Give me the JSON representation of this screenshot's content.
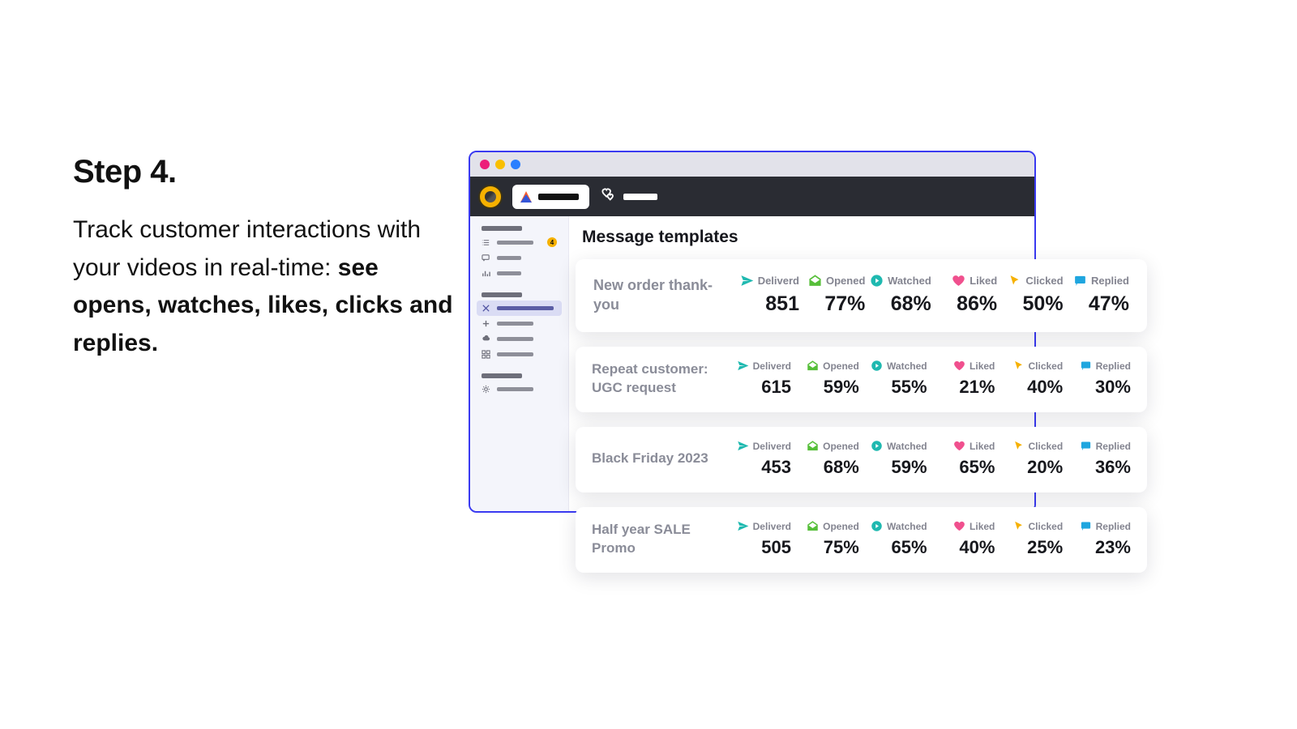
{
  "left": {
    "title": "Step 4.",
    "line1": "Track customer interactions with your videos in real-time: ",
    "bold": "see opens, watches, likes, clicks and replies."
  },
  "page": {
    "title": "Message templates"
  },
  "sidebar": {
    "badge": "4"
  },
  "columns": {
    "delivered": "Deliverd",
    "opened": "Opened",
    "watched": "Watched",
    "liked": "Liked",
    "clicked": "Clicked",
    "replied": "Replied"
  },
  "templates": [
    {
      "name": "New order thank-you",
      "delivered": "851",
      "opened": "77%",
      "watched": "68%",
      "liked": "86%",
      "clicked": "50%",
      "replied": "47%"
    },
    {
      "name": "Repeat customer: UGC request",
      "delivered": "615",
      "opened": "59%",
      "watched": "55%",
      "liked": "21%",
      "clicked": "40%",
      "replied": "30%"
    },
    {
      "name": "Black Friday 2023",
      "delivered": "453",
      "opened": "68%",
      "watched": "59%",
      "liked": "65%",
      "clicked": "20%",
      "replied": "36%"
    },
    {
      "name": "Half year SALE Promo",
      "delivered": "505",
      "opened": "75%",
      "watched": "65%",
      "liked": "40%",
      "clicked": "25%",
      "replied": "23%"
    }
  ],
  "colors": {
    "delivered": "#1fb9b0",
    "opened": "#57bf3a",
    "watched": "#1fb9b0",
    "liked": "#f0508e",
    "clicked": "#f6b100",
    "replied": "#1fa6df"
  }
}
